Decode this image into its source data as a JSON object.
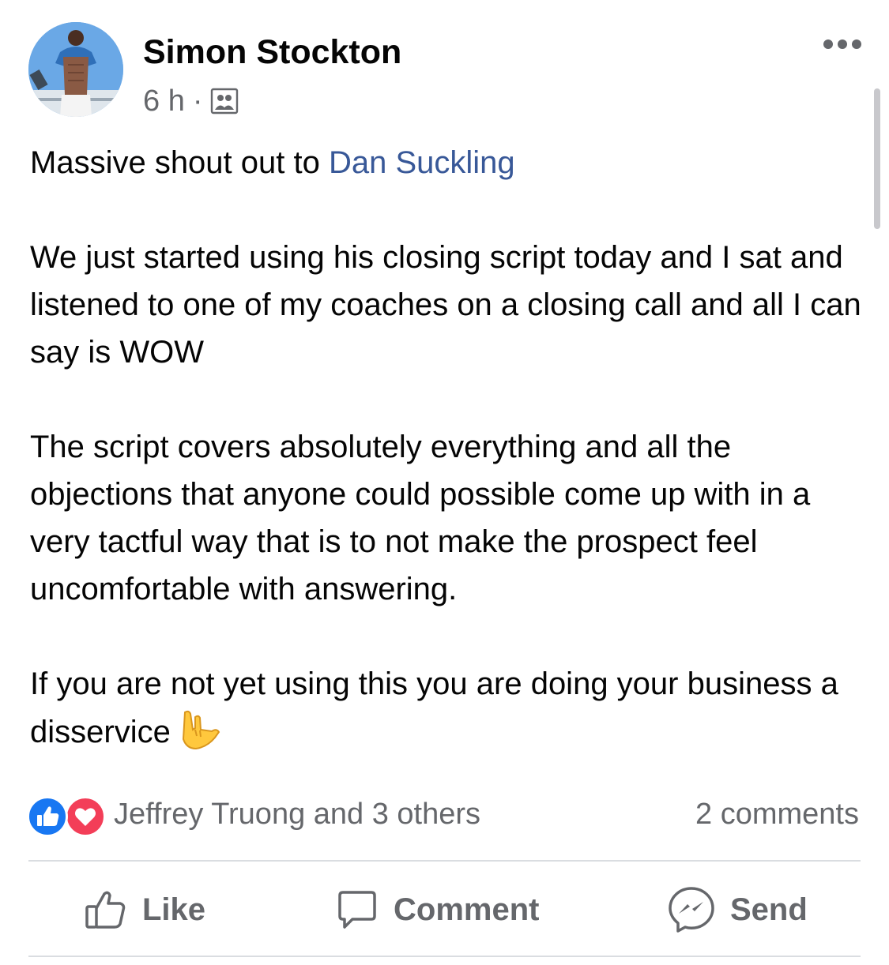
{
  "post": {
    "author": {
      "name": "Simon Stockton",
      "avatar_icon": "profile-photo"
    },
    "meta": {
      "time": "6 h",
      "separator": "·",
      "audience_icon": "friends-audience-icon"
    },
    "menu_icon": "more-options-icon",
    "body": {
      "intro": "Massive shout out to ",
      "mention": "Dan Suckling",
      "paragraph2": "We just started using his closing script today and I sat and listened to one of my coaches on a closing call and all I can say is WOW",
      "paragraph3": "The script covers absolutely everything and all the objections that anyone could possible come up with in a very tactful way that is to not make the prospect feel uncomfortable with answering.",
      "paragraph4": "If you are not yet using this you are doing your business a disservice",
      "emoji": "love-you-gesture-emoji"
    },
    "reactions": {
      "icons": [
        "like-reaction-icon",
        "love-reaction-icon"
      ],
      "text": "Jeffrey Truong and 3 others"
    },
    "comments_text": "2 comments",
    "actions": {
      "like": "Like",
      "comment": "Comment",
      "send": "Send"
    }
  },
  "colors": {
    "mention": "#385898",
    "secondary_text": "#65676b",
    "like_blue": "#1877f2",
    "love_red": "#f33e58",
    "divider": "#dadde1"
  }
}
